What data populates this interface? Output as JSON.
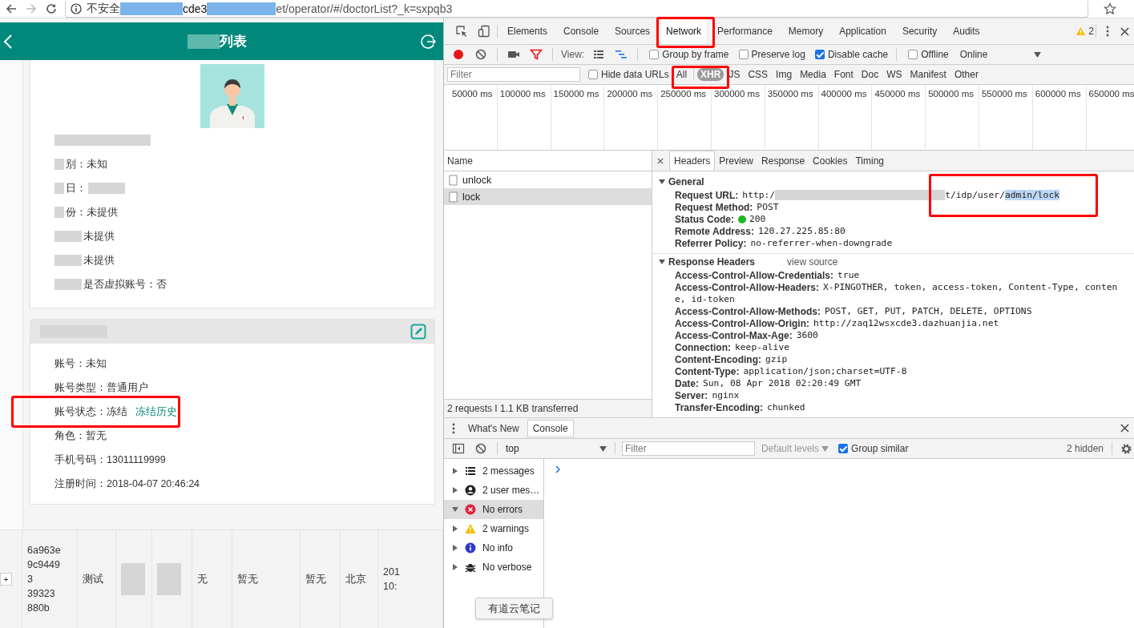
{
  "browser": {
    "security": "不安全",
    "url_mid": "cde3",
    "url_tail": "et/operator/#/doctorList?_k=sxpqb3"
  },
  "app": {
    "title": "列表",
    "profile_rows": [
      {
        "text": "别：未知"
      },
      {
        "text": "日："
      },
      {
        "text": "份：未提供"
      },
      {
        "text": "未提供"
      },
      {
        "text": "未提供"
      },
      {
        "text": "是否虚拟账号：否"
      }
    ],
    "account_rows": [
      {
        "text": "账号：未知"
      },
      {
        "text": "账号类型：普通用户"
      },
      {
        "text": "账号状态：冻结",
        "link": "冻结历史"
      },
      {
        "text": "角色：暂无"
      },
      {
        "text": "手机号码：13011119999"
      },
      {
        "text": "注册时间：2018-04-07 20:46:24"
      }
    ],
    "table_row": {
      "expand": "+",
      "cells": [
        {
          "redacted": false,
          "lines": [
            "6a963e",
            "9c9449",
            "3",
            "39323",
            "880b"
          ]
        },
        {
          "redacted": false,
          "lines": [
            "测试"
          ]
        },
        {
          "redacted": true
        },
        {
          "redacted": true
        },
        {
          "redacted": false,
          "lines": [
            "无"
          ]
        },
        {
          "redacted": false,
          "lines": [
            "暂无"
          ]
        },
        {
          "redacted": false,
          "lines": [
            "暂无"
          ]
        },
        {
          "redacted": false,
          "lines": [
            "北京"
          ]
        },
        {
          "redacted": false,
          "lines": [
            "201",
            "10:"
          ]
        }
      ]
    }
  },
  "devtools": {
    "tabs": [
      {
        "label": "Elements",
        "selected": false
      },
      {
        "label": "Console",
        "selected": false
      },
      {
        "label": "Sources",
        "selected": false
      },
      {
        "label": "Network",
        "selected": true
      },
      {
        "label": "Performance",
        "selected": false
      },
      {
        "label": "Memory",
        "selected": false
      },
      {
        "label": "Application",
        "selected": false
      },
      {
        "label": "Security",
        "selected": false
      },
      {
        "label": "Audits",
        "selected": false
      }
    ],
    "warning_count": "2",
    "toolbar": {
      "recording": true,
      "view_label": "View:",
      "options": [
        {
          "label": "Group by frame",
          "checked": false
        },
        {
          "label": "Preserve log",
          "checked": false
        },
        {
          "label": "Disable cache",
          "checked": true
        },
        {
          "label": "Offline",
          "checked": false
        }
      ],
      "throttle": "Online"
    },
    "filter": {
      "placeholder": "Filter",
      "hide_data_urls": {
        "label": "Hide data URLs",
        "checked": false
      },
      "types": [
        {
          "label": "All",
          "selected": false
        },
        {
          "label": "XHR",
          "selected": true
        },
        {
          "label": "JS",
          "selected": false
        },
        {
          "label": "CSS",
          "selected": false
        },
        {
          "label": "Img",
          "selected": false
        },
        {
          "label": "Media",
          "selected": false
        },
        {
          "label": "Font",
          "selected": false
        },
        {
          "label": "Doc",
          "selected": false
        },
        {
          "label": "WS",
          "selected": false
        },
        {
          "label": "Manifest",
          "selected": false
        },
        {
          "label": "Other",
          "selected": false
        }
      ]
    },
    "timeline_ticks": [
      "50000 ms",
      "100000 ms",
      "150000 ms",
      "200000 ms",
      "250000 ms",
      "300000 ms",
      "350000 ms",
      "400000 ms",
      "450000 ms",
      "500000 ms",
      "550000 ms",
      "600000 ms",
      "650000 ms"
    ],
    "requests": {
      "header": "Name",
      "rows": [
        {
          "name": "unlock",
          "selected": false
        },
        {
          "name": "lock",
          "selected": true
        }
      ],
      "summary": "2 requests I 1.1 KB transferred"
    },
    "detail_tabs": [
      {
        "label": "Headers",
        "selected": true
      },
      {
        "label": "Preview",
        "selected": false
      },
      {
        "label": "Response",
        "selected": false
      },
      {
        "label": "Cookies",
        "selected": false
      },
      {
        "label": "Timing",
        "selected": false
      }
    ],
    "general": {
      "title": "General",
      "expanded": true,
      "rows": [
        {
          "kind": "url",
          "name": "Request URL:",
          "value": "http:/",
          "value_end": "t/idp/user/",
          "selection": "admin/lock"
        },
        {
          "kind": "plain",
          "name": "Request Method:",
          "value": "POST"
        },
        {
          "kind": "status",
          "name": "Status Code:",
          "value": "200"
        },
        {
          "kind": "plain",
          "name": "Remote Address:",
          "value": "120.27.225.85:80"
        },
        {
          "kind": "plain",
          "name": "Referrer Policy:",
          "value": "no-referrer-when-downgrade"
        }
      ]
    },
    "response_headers": {
      "title": "Response Headers",
      "expanded": true,
      "view_source": "view source",
      "rows": [
        {
          "name": "Access-Control-Allow-Credentials:",
          "value": "true"
        },
        {
          "name": "Access-Control-Allow-Headers:",
          "value": "X-PINGOTHER, token, access-token, Content-Type, conten",
          "continuation": "e, id-token"
        },
        {
          "name": "Access-Control-Allow-Methods:",
          "value": "POST, GET, PUT, PATCH, DELETE, OPTIONS"
        },
        {
          "name": "Access-Control-Allow-Origin:",
          "value": "http://zaq12wsxcde3.dazhuanjia.net"
        },
        {
          "name": "Access-Control-Max-Age:",
          "value": "3600"
        },
        {
          "name": "Connection:",
          "value": "keep-alive"
        },
        {
          "name": "Content-Encoding:",
          "value": "gzip"
        },
        {
          "name": "Content-Type:",
          "value": "application/json;charset=UTF-8"
        },
        {
          "name": "Date:",
          "value": "Sun, 08 Apr 2018 02:20:49 GMT"
        },
        {
          "name": "Server:",
          "value": "nginx"
        },
        {
          "name": "Transfer-Encoding:",
          "value": "chunked"
        }
      ]
    }
  },
  "drawer": {
    "tabs": [
      {
        "label": "What's New",
        "selected": false
      },
      {
        "label": "Console",
        "selected": true
      }
    ],
    "context": "top",
    "filter_placeholder": "Filter",
    "levels": "Default levels",
    "group_similar": {
      "label": "Group similar",
      "checked": true
    },
    "hidden": "2 hidden",
    "sidebar": [
      {
        "kind": "list",
        "label": "2 messages",
        "expanded": false,
        "selected": false
      },
      {
        "kind": "user",
        "label": "2 user mes…",
        "expanded": false,
        "selected": false
      },
      {
        "kind": "error",
        "label": "No errors",
        "expanded": true,
        "selected": true
      },
      {
        "kind": "warning",
        "label": "2 warnings",
        "expanded": false,
        "selected": false
      },
      {
        "kind": "info",
        "label": "No info",
        "expanded": false,
        "selected": false
      },
      {
        "kind": "verbose",
        "label": "No verbose",
        "expanded": false,
        "selected": false
      }
    ]
  },
  "tooltip": "有道云笔记"
}
